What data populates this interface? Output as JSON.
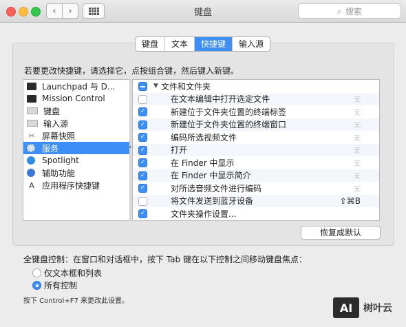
{
  "window": {
    "title": "键盘",
    "search_placeholder": "搜索",
    "nav_back": "‹",
    "nav_forward": "›"
  },
  "tabs": [
    {
      "label": "键盘",
      "active": false
    },
    {
      "label": "文本",
      "active": false
    },
    {
      "label": "快捷键",
      "active": true
    },
    {
      "label": "输入源",
      "active": false
    }
  ],
  "instruction": "若要更改快捷键，请选择它，点按组合键，然后键入新键。",
  "categories": [
    {
      "label": "Launchpad 与 D...",
      "icon": "launchpad-icon",
      "selected": false
    },
    {
      "label": "Mission Control",
      "icon": "mission-control-icon",
      "selected": false
    },
    {
      "label": "键盘",
      "icon": "keyboard-icon",
      "selected": false
    },
    {
      "label": "输入源",
      "icon": "input-source-icon",
      "selected": false
    },
    {
      "label": "屏幕快照",
      "icon": "screenshot-icon",
      "selected": false
    },
    {
      "label": "服务",
      "icon": "services-gear-icon",
      "selected": true
    },
    {
      "label": "Spotlight",
      "icon": "spotlight-icon",
      "selected": false
    },
    {
      "label": "辅助功能",
      "icon": "accessibility-icon",
      "selected": false
    },
    {
      "label": "应用程序快捷键",
      "icon": "app-shortcuts-icon",
      "selected": false
    }
  ],
  "shortcuts": [
    {
      "label": "文件和文件夹",
      "state": "mixed",
      "group": true,
      "key": ""
    },
    {
      "label": "在文本编辑中打开选定文件",
      "state": "off",
      "group": false,
      "key": "无"
    },
    {
      "label": "新建位于文件夹位置的终端标签",
      "state": "on",
      "group": false,
      "key": "无"
    },
    {
      "label": "新建位于文件夹位置的终端窗口",
      "state": "on",
      "group": false,
      "key": "无"
    },
    {
      "label": "编码所选视频文件",
      "state": "on",
      "group": false,
      "key": "无"
    },
    {
      "label": "打开",
      "state": "on",
      "group": false,
      "key": "无"
    },
    {
      "label": "在 Finder 中显示",
      "state": "on",
      "group": false,
      "key": "无"
    },
    {
      "label": "在 Finder 中显示简介",
      "state": "on",
      "group": false,
      "key": "无"
    },
    {
      "label": "对所选音频文件进行编码",
      "state": "on",
      "group": false,
      "key": "无"
    },
    {
      "label": "将文件发送到蓝牙设备",
      "state": "off",
      "group": false,
      "key": "⇧⌘B"
    },
    {
      "label": "文件夹操作设置...",
      "state": "on",
      "group": false,
      "key": ""
    }
  ],
  "restore_button": "恢复成默认",
  "full_keyboard": {
    "label": "全键盘控制：在窗口和对话框中，按下 Tab 键在以下控制之间移动键盘焦点：",
    "options": [
      {
        "label": "仅文本框和列表",
        "selected": false
      },
      {
        "label": "所有控制",
        "selected": true
      }
    ],
    "hint": "按下 Control+F7 来更改此设置。"
  },
  "watermark": {
    "logo": "AI",
    "text": "树叶云"
  },
  "colors": {
    "accent": "#3d8ef5",
    "window_bg": "#ececec"
  }
}
